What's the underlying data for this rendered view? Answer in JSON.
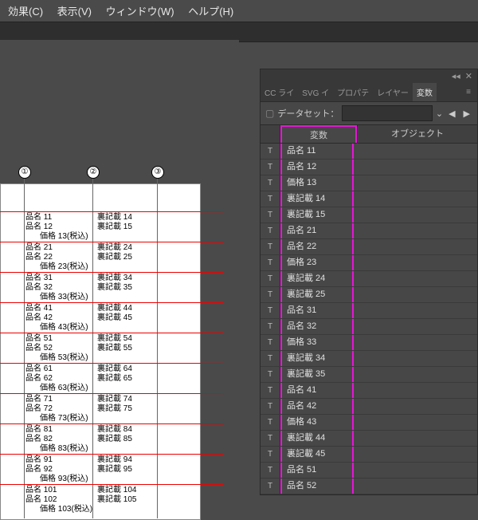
{
  "menubar": {
    "items": [
      "効果(C)",
      "表示(V)",
      "ウィンドウ(W)",
      "ヘルプ(H)"
    ]
  },
  "markers": [
    "①",
    "②",
    "③"
  ],
  "doc_rows": [
    {
      "a": "品名 11",
      "b": "品名 12",
      "p": "価格 13(税込)",
      "c": "裏記載 14",
      "d": "裏記載 15"
    },
    {
      "a": "品名 21",
      "b": "品名 22",
      "p": "価格 23(税込)",
      "c": "裏記載 24",
      "d": "裏記載 25"
    },
    {
      "a": "品名 31",
      "b": "品名 32",
      "p": "価格 33(税込)",
      "c": "裏記載 34",
      "d": "裏記載 35"
    },
    {
      "a": "品名 41",
      "b": "品名 42",
      "p": "価格 43(税込)",
      "c": "裏記載 44",
      "d": "裏記載 45"
    },
    {
      "a": "品名 51",
      "b": "品名 52",
      "p": "価格 53(税込)",
      "c": "裏記載 54",
      "d": "裏記載 55"
    },
    {
      "a": "品名 61",
      "b": "品名 62",
      "p": "価格 63(税込)",
      "c": "裏記載 64",
      "d": "裏記載 65"
    },
    {
      "a": "品名 71",
      "b": "品名 72",
      "p": "価格 73(税込)",
      "c": "裏記載 74",
      "d": "裏記載 75"
    },
    {
      "a": "品名 81",
      "b": "品名 82",
      "p": "価格 83(税込)",
      "c": "裏記載 84",
      "d": "裏記載 85"
    },
    {
      "a": "品名 91",
      "b": "品名 92",
      "p": "価格 93(税込)",
      "c": "裏記載 94",
      "d": "裏記載 95"
    },
    {
      "a": "品名 101",
      "b": "品名 102",
      "p": "価格 103(税込)",
      "c": "裏記載 104",
      "d": "裏記載 105"
    }
  ],
  "panel": {
    "collapse": "◂◂",
    "close": "✕",
    "tabs": [
      "CC ライ",
      "SVG イ",
      "プロパテ",
      "レイヤー",
      "変数"
    ],
    "active_tab": "変数",
    "dataset_label": "データセット：",
    "head_var": "変数",
    "head_obj": "オブジェクト",
    "prev": "◀",
    "next": "▶",
    "vars": [
      "品名 11",
      "品名 12",
      "価格 13",
      "裏記載 14",
      "裏記載 15",
      "品名 21",
      "品名 22",
      "価格 23",
      "裏記載 24",
      "裏記載 25",
      "品名 31",
      "品名 32",
      "価格 33",
      "裏記載 34",
      "裏記載 35",
      "品名 41",
      "品名 42",
      "価格 43",
      "裏記載 44",
      "裏記載 45",
      "品名 51",
      "品名 52"
    ]
  }
}
